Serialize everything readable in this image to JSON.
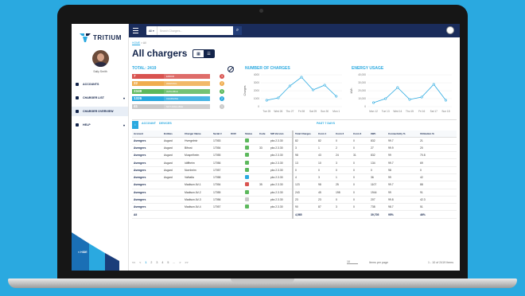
{
  "app": {
    "brand": "TRITIUM",
    "user_name": "Sally Smith"
  },
  "sidebar": {
    "items": [
      {
        "label": "ACCOUNTS",
        "icon": "user-icon",
        "chevron": ""
      },
      {
        "label": "CHARGER LIST",
        "icon": "list-icon",
        "chevron": "▾"
      },
      {
        "label": "CHARGER OVERVIEW",
        "icon": "grid-icon",
        "chevron": ""
      },
      {
        "label": "HELP",
        "icon": "help-icon",
        "chevron": "▾"
      }
    ],
    "hide_label": "< HIDE"
  },
  "topbar": {
    "search_filter": "All ▾",
    "search_placeholder": "Search Chargers..."
  },
  "breadcrumb": {
    "home": "HOME",
    "sep": " > ",
    "current": "All"
  },
  "page_title": "All chargers",
  "total": "TOTAL: 2419",
  "statuses": [
    {
      "count": "7",
      "label": "ERROR",
      "color": "#d9534f",
      "dot": "3"
    },
    {
      "count": "22",
      "label": "WARNING",
      "color": "#f0ad4e",
      "dot": "2"
    },
    {
      "count": "2349",
      "label": "AVAILABLE",
      "color": "#5cb85c",
      "dot": "1"
    },
    {
      "count": "1326",
      "label": "CHARGING",
      "color": "#2aa9e0",
      "dot": "2"
    },
    {
      "count": "41",
      "label": "NOT AVAILABLE",
      "color": "#c8c8c8",
      "dot": "1"
    }
  ],
  "colors": {
    "accent": "#2aa9e0",
    "navy": "#13244a",
    "topbar": "#1a2c5b"
  },
  "chart_data": [
    {
      "type": "line",
      "title": "NUMBER OF CHARGES",
      "ylabel": "Charges",
      "ylim": [
        0,
        4000
      ],
      "yticks": [
        "4000",
        "3000",
        "2000",
        "1000",
        "0"
      ],
      "categories": [
        "Tue 25",
        "Wed 26",
        "Thu 27",
        "Fri 28",
        "Sat 29",
        "Sun 30",
        "Mon 1"
      ],
      "values": [
        800,
        1100,
        2600,
        3700,
        2100,
        2700,
        1300
      ]
    },
    {
      "type": "line",
      "title": "ENERGY USAGE",
      "ylabel": "kWh",
      "ylim": [
        0,
        40000
      ],
      "yticks": [
        "40,000",
        "30,000",
        "20,000",
        "10,000",
        "0"
      ],
      "categories": [
        "Mon 12",
        "Tue 13",
        "Wed 14",
        "Thu 15",
        "Fri 16",
        "Sat 17",
        "Sun 18"
      ],
      "values": [
        5000,
        10000,
        24000,
        9000,
        12000,
        28000,
        8000
      ]
    }
  ],
  "table": {
    "tab_account": "ACCOUNT",
    "tab_devices": "DEVICES",
    "tab_past": "PAST 7 DAYS",
    "headers": [
      "Account",
      "Entities",
      "Charger Name",
      "Serial #",
      "OCR",
      "Status",
      "Code",
      "SW Version",
      "Total Charges",
      "Conn 1",
      "Conn 2",
      "Conn 3",
      "kWh",
      "Connectivity %",
      "Utilization %"
    ],
    "rows": [
      [
        "Avengers",
        "Asgard",
        "Hvergelmir",
        "17053",
        "",
        "green",
        "",
        "pks 2.3.30",
        "82",
        "82",
        "0",
        "0",
        "832",
        "99.7",
        "21"
      ],
      [
        "Avengers",
        "Asgard",
        "Bifrost",
        "17054",
        "",
        "green",
        "33",
        "pks 2.3.30",
        "3",
        "1",
        "2",
        "0",
        "27",
        "99.9",
        "20"
      ],
      [
        "Avengers",
        "Asgard",
        "Muspelheim",
        "17055",
        "",
        "green",
        "",
        "pks 2.3.30",
        "98",
        "43",
        "24",
        "31",
        "832",
        "99",
        "70.8"
      ],
      [
        "Avengers",
        "Asgard",
        "Idiffheim",
        "17056",
        "",
        "green",
        "",
        "pks 2.3.30",
        "13",
        "10",
        "3",
        "0",
        "134",
        "99.7",
        "69"
      ],
      [
        "Avengers",
        "Asgard",
        "Nornheim",
        "17057",
        "",
        "green",
        "",
        "pks 2.3.30",
        "0",
        "0",
        "0",
        "0",
        "0",
        "98",
        "0"
      ],
      [
        "Avengers",
        "Asgard",
        "Valhalla",
        "17058",
        "",
        "blue",
        "",
        "pks 2.3.30",
        "4",
        "3",
        "1",
        "0",
        "36",
        "99",
        "42"
      ],
      [
        "Avengers",
        "",
        "Madison AV-1",
        "17054",
        "",
        "red",
        "35",
        "pks 2.3.30",
        "123",
        "98",
        "25",
        "0",
        "1107",
        "99.7",
        "88"
      ],
      [
        "Avengers",
        "",
        "Madison AV-2",
        "17055",
        "",
        "green",
        "",
        "pks 2.3.30",
        "243",
        "45",
        "198",
        "0",
        "1944",
        "99",
        "91"
      ],
      [
        "Avengers",
        "",
        "Madison AV-3",
        "17056",
        "",
        "grey",
        "",
        "pks 2.3.30",
        "23",
        "23",
        "0",
        "0",
        "207",
        "99.8",
        "42.3"
      ],
      [
        "Avengers",
        "",
        "Madison AV-4",
        "17057",
        "",
        "green",
        "",
        "pks 2.3.30",
        "90",
        "87",
        "3",
        "0",
        "738",
        "98.7",
        "51"
      ]
    ],
    "totals": [
      "All",
      "",
      "",
      "",
      "",
      "",
      "",
      "",
      "4,565",
      "",
      "",
      "",
      "39,705",
      "95%",
      "46%"
    ]
  },
  "pager": {
    "pages": [
      "<<",
      "<",
      "1",
      "2",
      "3",
      "4",
      "5",
      "...",
      ">",
      ">>"
    ],
    "per_page": "10",
    "per_page_label": "Items per page",
    "range": "1 - 10 of 2419 Items"
  }
}
